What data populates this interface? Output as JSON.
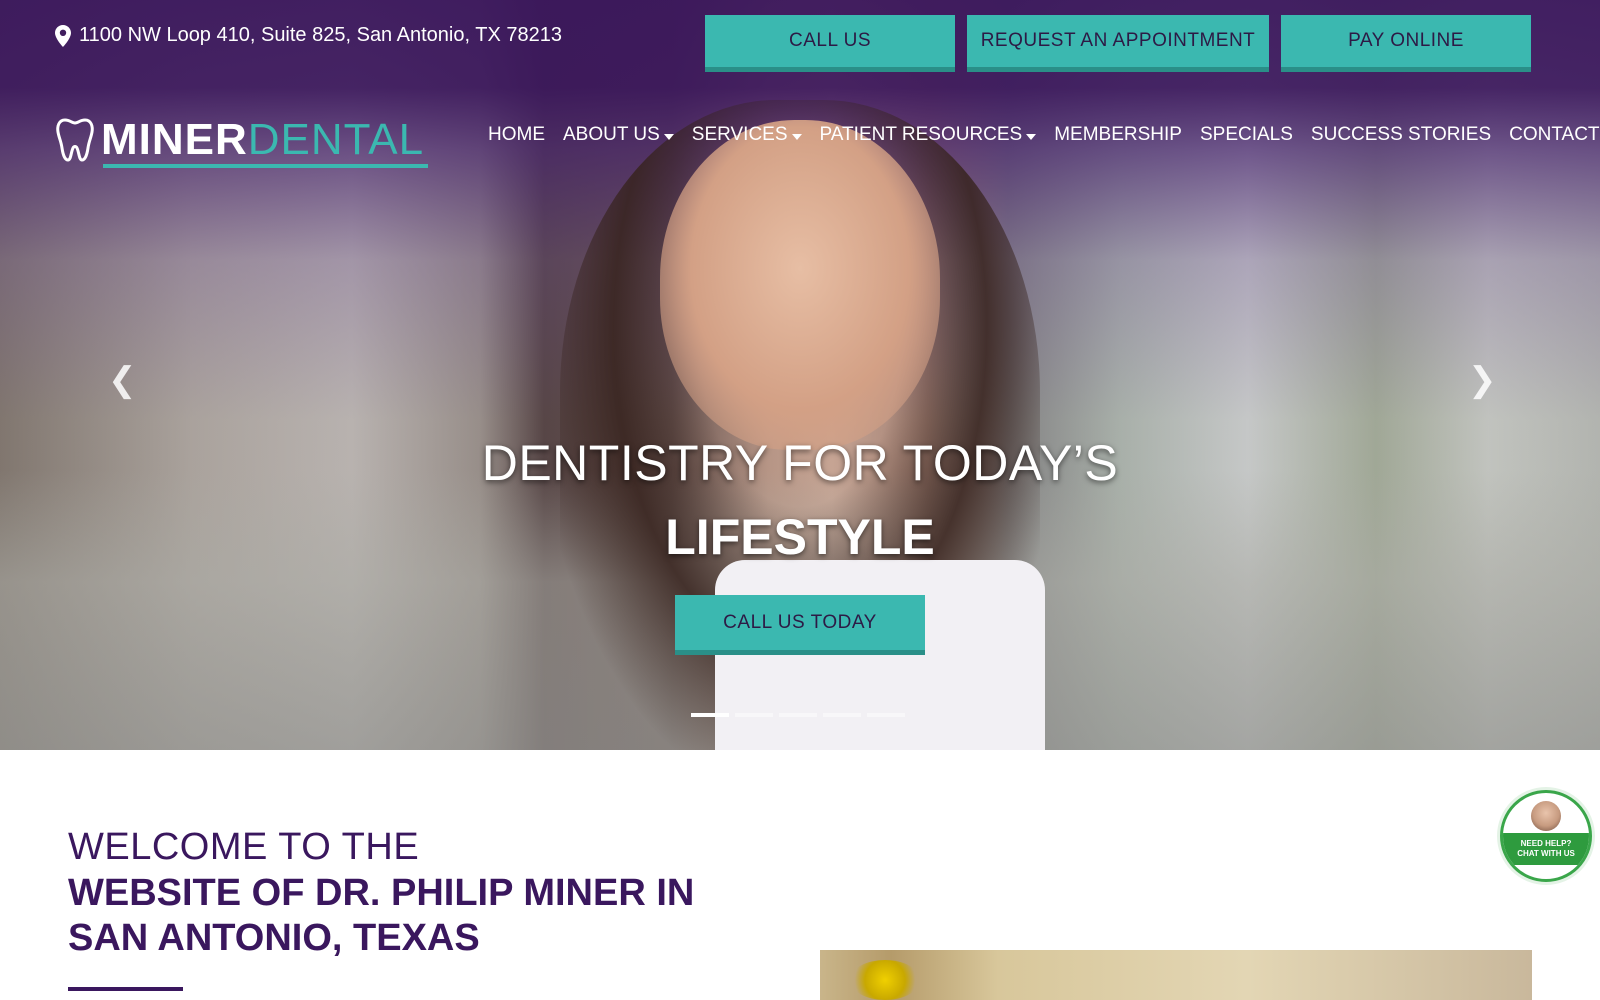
{
  "topbar": {
    "address": "1100 NW Loop 410, Suite 825, San Antonio, TX 78213",
    "buttons": {
      "call": "CALL US",
      "appointment": "REQUEST AN APPOINTMENT",
      "pay": "PAY ONLINE"
    }
  },
  "logo": {
    "part1": "MINER",
    "part2": "DENTAL"
  },
  "nav": {
    "items": [
      {
        "label": "HOME"
      },
      {
        "label": "ABOUT US"
      },
      {
        "label": "SERVICES"
      },
      {
        "label": "PATIENT RESOURCES"
      },
      {
        "label": "MEMBERSHIP"
      },
      {
        "label": "SPECIALS"
      },
      {
        "label": "SUCCESS STORIES"
      },
      {
        "label": "CONTACT US"
      }
    ]
  },
  "hero": {
    "headline_line1": "DENTISTRY FOR TODAY’S",
    "headline_line2": "LIFESTYLE",
    "cta": "CALL US TODAY",
    "slide_count": 5,
    "active_slide": 1
  },
  "welcome": {
    "line1": "WELCOME TO THE",
    "line2": "WEBSITE OF DR. PHILIP MINER IN",
    "line3": "SAN ANTONIO, TEXAS"
  },
  "chat": {
    "label_line1": "NEED HELP?",
    "label_line2": "CHAT WITH US"
  },
  "colors": {
    "primary_purple": "#3a175e",
    "teal": "#3bb8b0",
    "teal_dark": "#2a8f88",
    "chat_green": "#2e9b3e"
  },
  "icons": {
    "address": "map-pin-icon",
    "logo": "tooth-icon",
    "prev": "chevron-left-icon",
    "next": "chevron-right-icon"
  }
}
